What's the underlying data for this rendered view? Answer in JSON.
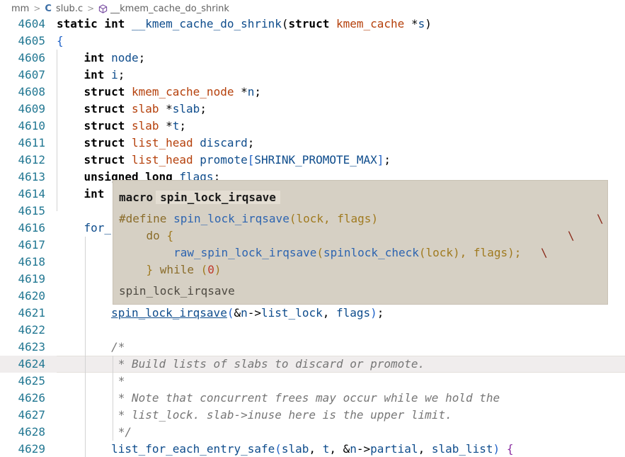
{
  "breadcrumb": {
    "folder": "mm",
    "file_icon": "C",
    "file": "slub.c",
    "symbol_icon": "cube-icon",
    "symbol": "__kmem_cache_do_shrink"
  },
  "lines": [
    {
      "n": "4604",
      "tokens": [
        [
          "kw",
          "static int "
        ],
        [
          "id",
          "__kmem_cache_do_shrink"
        ],
        [
          "op",
          "("
        ],
        [
          "kw",
          "struct "
        ],
        [
          "ty",
          "kmem_cache "
        ],
        [
          "op",
          "*"
        ],
        [
          "id",
          "s"
        ],
        [
          "op",
          ")"
        ]
      ]
    },
    {
      "n": "4605",
      "tokens": [
        [
          "br",
          "{"
        ]
      ]
    },
    {
      "n": "4606",
      "tokens": [
        [
          "op",
          "    "
        ],
        [
          "kw",
          "int "
        ],
        [
          "id",
          "node"
        ],
        [
          "op",
          ";"
        ]
      ]
    },
    {
      "n": "4607",
      "tokens": [
        [
          "op",
          "    "
        ],
        [
          "kw",
          "int "
        ],
        [
          "id",
          "i"
        ],
        [
          "op",
          ";"
        ]
      ]
    },
    {
      "n": "4608",
      "tokens": [
        [
          "op",
          "    "
        ],
        [
          "kw",
          "struct "
        ],
        [
          "ty",
          "kmem_cache_node "
        ],
        [
          "op",
          "*"
        ],
        [
          "id",
          "n"
        ],
        [
          "op",
          ";"
        ]
      ]
    },
    {
      "n": "4609",
      "tokens": [
        [
          "op",
          "    "
        ],
        [
          "kw",
          "struct "
        ],
        [
          "ty",
          "slab "
        ],
        [
          "op",
          "*"
        ],
        [
          "id",
          "slab"
        ],
        [
          "op",
          ";"
        ]
      ]
    },
    {
      "n": "4610",
      "tokens": [
        [
          "op",
          "    "
        ],
        [
          "kw",
          "struct "
        ],
        [
          "ty",
          "slab "
        ],
        [
          "op",
          "*"
        ],
        [
          "id",
          "t"
        ],
        [
          "op",
          ";"
        ]
      ]
    },
    {
      "n": "4611",
      "tokens": [
        [
          "op",
          "    "
        ],
        [
          "kw",
          "struct "
        ],
        [
          "ty",
          "list_head "
        ],
        [
          "id",
          "discard"
        ],
        [
          "op",
          ";"
        ]
      ]
    },
    {
      "n": "4612",
      "tokens": [
        [
          "op",
          "    "
        ],
        [
          "kw",
          "struct "
        ],
        [
          "ty",
          "list_head "
        ],
        [
          "id",
          "promote"
        ],
        [
          "br",
          "["
        ],
        [
          "mac",
          "SHRINK_PROMOTE_MAX"
        ],
        [
          "br",
          "]"
        ],
        [
          "op",
          ";"
        ]
      ]
    },
    {
      "n": "4613",
      "tokens": [
        [
          "op",
          "    "
        ],
        [
          "kw",
          "unsigned long "
        ],
        [
          "id",
          "flags"
        ],
        [
          "op",
          ";"
        ]
      ]
    },
    {
      "n": "4614",
      "tokens": [
        [
          "op",
          "    "
        ],
        [
          "kw",
          "int "
        ]
      ]
    },
    {
      "n": "4615",
      "tokens": []
    },
    {
      "n": "4616",
      "tokens": [
        [
          "op",
          "    "
        ],
        [
          "id",
          "for_"
        ]
      ]
    },
    {
      "n": "4617",
      "tokens": []
    },
    {
      "n": "4618",
      "tokens": []
    },
    {
      "n": "4619",
      "tokens": []
    },
    {
      "n": "4620",
      "tokens": []
    },
    {
      "n": "4621",
      "tokens": [
        [
          "op",
          "        "
        ],
        [
          "link",
          "spin_lock_irqsave"
        ],
        [
          "br",
          "("
        ],
        [
          "op",
          "&"
        ],
        [
          "id",
          "n"
        ],
        [
          "op",
          "->"
        ],
        [
          "id",
          "list_lock"
        ],
        [
          "op",
          ", "
        ],
        [
          "id",
          "flags"
        ],
        [
          "br",
          ")"
        ],
        [
          "op",
          ";"
        ]
      ]
    },
    {
      "n": "4622",
      "tokens": []
    },
    {
      "n": "4623",
      "tokens": [
        [
          "op",
          "        "
        ],
        [
          "cm",
          "/*"
        ]
      ]
    },
    {
      "n": "4624",
      "tokens": [
        [
          "op",
          "        "
        ],
        [
          "cm",
          " * Build lists of slabs to discard or promote."
        ]
      ],
      "current": true
    },
    {
      "n": "4625",
      "tokens": [
        [
          "op",
          "        "
        ],
        [
          "cm",
          " *"
        ]
      ]
    },
    {
      "n": "4626",
      "tokens": [
        [
          "op",
          "        "
        ],
        [
          "cm",
          " * Note that concurrent frees may occur while we hold the"
        ]
      ]
    },
    {
      "n": "4627",
      "tokens": [
        [
          "op",
          "        "
        ],
        [
          "cm",
          " * list_lock. slab->inuse here is the upper limit."
        ]
      ]
    },
    {
      "n": "4628",
      "tokens": [
        [
          "op",
          "        "
        ],
        [
          "cm",
          " */"
        ]
      ]
    },
    {
      "n": "4629",
      "tokens": [
        [
          "op",
          "        "
        ],
        [
          "id",
          "list_for_each_entry_safe"
        ],
        [
          "br",
          "("
        ],
        [
          "id",
          "slab"
        ],
        [
          "op",
          ", "
        ],
        [
          "id",
          "t"
        ],
        [
          "op",
          ", &"
        ],
        [
          "id",
          "n"
        ],
        [
          "op",
          "->"
        ],
        [
          "id",
          "partial"
        ],
        [
          "op",
          ", "
        ],
        [
          "id",
          "slab_list"
        ],
        [
          "br",
          ")"
        ],
        [
          "op",
          " "
        ],
        [
          "br2",
          "{"
        ]
      ]
    }
  ],
  "hover": {
    "kind": "macro",
    "name": "spin_lock_irqsave",
    "def_lines": [
      [
        [
          "hkw",
          "#define "
        ],
        [
          "hid",
          "spin_lock_irqsave"
        ],
        [
          "hp",
          "("
        ],
        [
          "hp",
          "lock, flags"
        ],
        [
          "hp",
          ")"
        ]
      ],
      [
        [
          "hkw",
          "    do "
        ],
        [
          "hp",
          "{"
        ]
      ],
      [
        [
          "hkw",
          "        "
        ],
        [
          "hid",
          "raw_spin_lock_irqsave"
        ],
        [
          "hp",
          "("
        ],
        [
          "hid",
          "spinlock_check"
        ],
        [
          "hp",
          "(lock), flags); "
        ]
      ],
      [
        [
          "hkw",
          "    "
        ],
        [
          "hp",
          "} "
        ],
        [
          "hkw",
          "while "
        ],
        [
          "hp",
          "("
        ],
        [
          "hnum",
          "0"
        ],
        [
          "hp",
          ")"
        ]
      ]
    ],
    "footer": "spin_lock_irqsave"
  }
}
